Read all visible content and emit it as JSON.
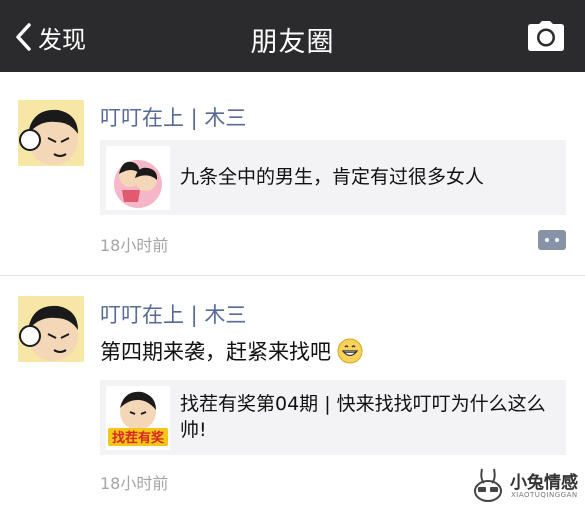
{
  "navbar": {
    "back_label": "发现",
    "title": "朋友圈"
  },
  "posts": [
    {
      "username": "叮叮在上 | 木三",
      "card_text": "九条全中的男生，肯定有过很多女人",
      "time": "18小时前"
    },
    {
      "username": "叮叮在上 | 木三",
      "text": "第四期来袭，赶紧来找吧",
      "card_text": "找茬有奖第04期 | 快来找找叮叮为什么这么帅!",
      "card_badge": "找茬有奖",
      "time": "18小时前"
    }
  ],
  "watermark": {
    "name": "小兔情感",
    "sub": "XIAOTUQINGGAN"
  },
  "colors": {
    "navbar_bg": "#2b2b2d",
    "username": "#576b95",
    "time": "#a5a5a5",
    "card_bg": "#f3f3f5"
  }
}
